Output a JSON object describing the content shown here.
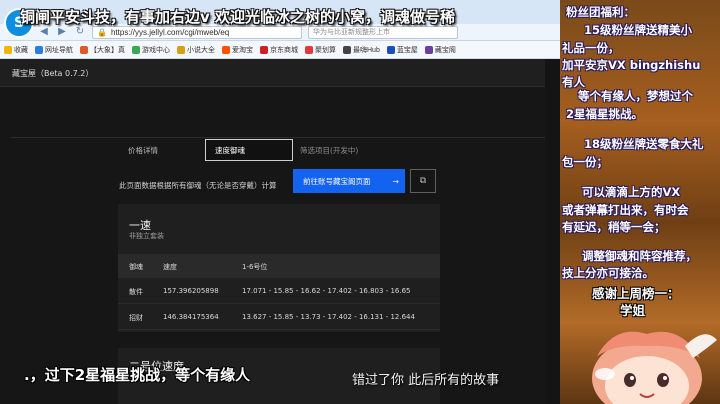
{
  "stream": {
    "ticker": "铜闸平安斗技，有事加右边v  欢迎光临冰之树的小窝，调魂做号稀",
    "subtitle_left": ".，过下2星福星挑战，等个有缘人",
    "subtitle_right": "错过了你 此后所有的故事",
    "logo_glyph": "S"
  },
  "panel": {
    "lines": [
      "粉丝团福利：",
      "15级粉丝牌送精美小",
      "礼品一份，",
      "加平安京VX bingzhishu",
      "有人",
      "等个有缘人，梦想过个",
      "2星福星挑战。",
      "18级粉丝牌送零食大礼",
      "包一份；",
      "可以滴滴上方的VX",
      "或者弹幕打出来，有时会",
      "有延迟，稍等一会；",
      "调整御魂和阵容推荐，",
      "技上分亦可接洽。"
    ],
    "thanks_1": "感谢上周榜一：",
    "thanks_2": "学姐"
  },
  "browser": {
    "back": "◀",
    "forward": "▶",
    "refresh": "↻",
    "lock": "🔒",
    "url": "https://yys.jellyl.com/cgi/mweb/eq",
    "search_placeholder": "华为与比亚新规整形上市"
  },
  "bookmarks": [
    {
      "label": "收藏",
      "color": "#f5b400"
    },
    {
      "label": "网址导航",
      "color": "#2a7de1"
    },
    {
      "label": "【大象】真",
      "color": "#e05a28"
    },
    {
      "label": "游戏中心",
      "color": "#3aa757"
    },
    {
      "label": "小说大全",
      "color": "#d4a017"
    },
    {
      "label": "爱淘宝",
      "color": "#ff5000"
    },
    {
      "label": "京东商城",
      "color": "#d01f24"
    },
    {
      "label": "聚划算",
      "color": "#e4393c"
    },
    {
      "label": "最嗨Hub",
      "color": "#444"
    },
    {
      "label": "蓝宝屋",
      "color": "#1a4dbb"
    },
    {
      "label": "藏宝阁",
      "color": "#6b3fa0"
    }
  ],
  "site": {
    "title": "藏宝屋（Beta 0.7.2）",
    "goto_button": "前往账号藏宝阁页面",
    "goto_arrow": "→",
    "copy_icon": "⧉",
    "tabs": [
      "价格详情",
      "速度御魂",
      "筛选项目(开发中)"
    ],
    "description": "此页面数据根据所有御魂（无论是否穿戴）计算",
    "card1": {
      "title": "一速",
      "subtitle": "非独立套装",
      "headers": [
        "御魂",
        "速度",
        "1-6号位"
      ],
      "rows": [
        [
          "散件",
          "157.396205898",
          "17.071 - 15.85 - 16.62 - 17.402 - 16.803 - 16.65"
        ],
        [
          "招财",
          "146.384175364",
          "13.627 - 15.85 - 13.73 - 17.402 - 16.131 - 12.644"
        ]
      ]
    },
    "card2_title": "二号位速度"
  }
}
